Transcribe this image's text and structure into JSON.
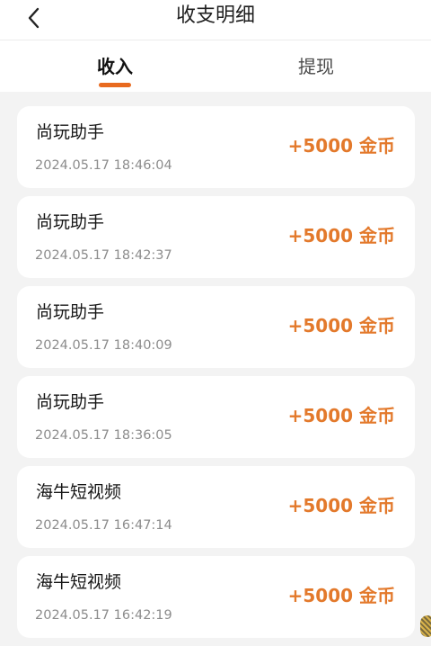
{
  "header": {
    "title": "收支明细",
    "back_icon": "chevron-left-icon"
  },
  "tabs": [
    {
      "label": "收入",
      "active": true
    },
    {
      "label": "提现",
      "active": false
    }
  ],
  "colors": {
    "accent": "#e86a1f",
    "amount": "#e3792b",
    "background": "#f3f3f3"
  },
  "records": [
    {
      "name": "尚玩助手",
      "time": "2024.05.17 18:46:04",
      "amount": "+5000 金币"
    },
    {
      "name": "尚玩助手",
      "time": "2024.05.17 18:42:37",
      "amount": "+5000 金币"
    },
    {
      "name": "尚玩助手",
      "time": "2024.05.17 18:40:09",
      "amount": "+5000 金币"
    },
    {
      "name": "尚玩助手",
      "time": "2024.05.17 18:36:05",
      "amount": "+5000 金币"
    },
    {
      "name": "海牛短视频",
      "time": "2024.05.17 16:47:14",
      "amount": "+5000 金币"
    },
    {
      "name": "海牛短视频",
      "time": "2024.05.17 16:42:19",
      "amount": "+5000 金币"
    }
  ]
}
